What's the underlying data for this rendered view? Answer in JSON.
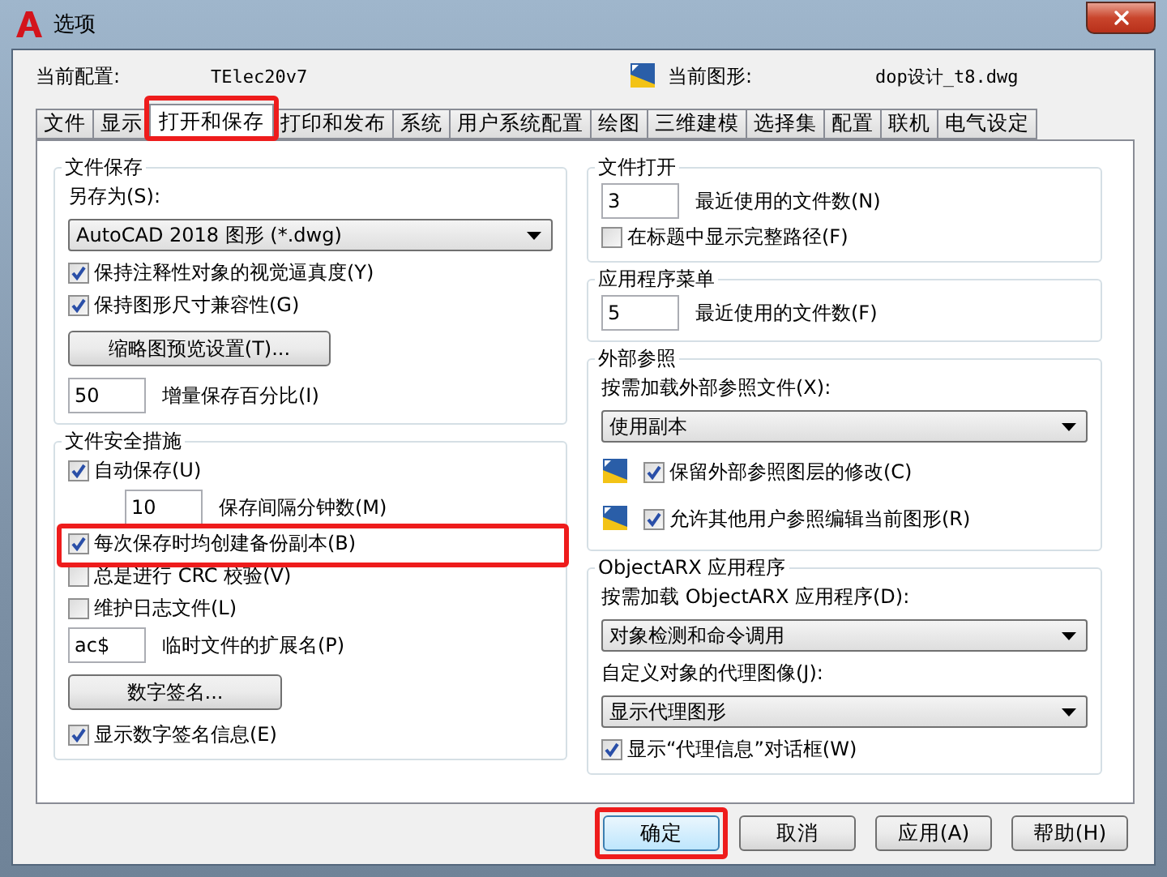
{
  "window": {
    "title": "选项"
  },
  "header": {
    "profile_label": "当前配置:",
    "profile": "TElec20v7",
    "drawing_label": "当前图形:",
    "drawing": "dop设计_t8.dwg"
  },
  "tabs": [
    {
      "label": "文件",
      "selected": false,
      "highlighted": false
    },
    {
      "label": "显示",
      "selected": false,
      "highlighted": false
    },
    {
      "label": "打开和保存",
      "selected": true,
      "highlighted": true
    },
    {
      "label": "打印和发布",
      "selected": false,
      "highlighted": false
    },
    {
      "label": "系统",
      "selected": false,
      "highlighted": false
    },
    {
      "label": "用户系统配置",
      "selected": false,
      "highlighted": false
    },
    {
      "label": "绘图",
      "selected": false,
      "highlighted": false
    },
    {
      "label": "三维建模",
      "selected": false,
      "highlighted": false
    },
    {
      "label": "选择集",
      "selected": false,
      "highlighted": false
    },
    {
      "label": "配置",
      "selected": false,
      "highlighted": false
    },
    {
      "label": "联机",
      "selected": false,
      "highlighted": false
    },
    {
      "label": "电气设定",
      "selected": false,
      "highlighted": false
    }
  ],
  "columns": [
    [
      {
        "title": "文件保存",
        "items": [
          {
            "kind": "label",
            "text": "另存为(S):"
          },
          {
            "kind": "select",
            "value": "AutoCAD 2018 图形 (*.dwg)"
          },
          {
            "kind": "checkbox",
            "label": "保持注释性对象的视觉逼真度(Y)",
            "checked": true,
            "highlighted": false
          },
          {
            "kind": "checkbox",
            "label": "保持图形尺寸兼容性(G)",
            "checked": true,
            "highlighted": false
          },
          {
            "kind": "button",
            "label": "缩略图预览设置(T)..."
          },
          {
            "kind": "field",
            "caption": "增量保存百分比(I)",
            "value": "50"
          }
        ]
      },
      {
        "title": "文件安全措施",
        "items": [
          {
            "kind": "checkbox",
            "label": "自动保存(U)",
            "checked": true,
            "highlighted": false
          },
          {
            "kind": "indented-field",
            "caption": "保存间隔分钟数(M)",
            "value": "10"
          },
          {
            "kind": "checkbox",
            "label": "每次保存时均创建备份副本(B)",
            "checked": true,
            "highlighted": true
          },
          {
            "kind": "checkbox",
            "label": "总是进行 CRC 校验(V)",
            "checked": false,
            "highlighted": false
          },
          {
            "kind": "checkbox",
            "label": "维护日志文件(L)",
            "checked": false,
            "highlighted": false
          },
          {
            "kind": "field",
            "caption": "临时文件的扩展名(P)",
            "value": "ac$"
          },
          {
            "kind": "button",
            "label": "数字签名..."
          },
          {
            "kind": "checkbox",
            "label": "显示数字签名信息(E)",
            "checked": true,
            "highlighted": false
          }
        ]
      }
    ],
    [
      {
        "title": "文件打开",
        "items": [
          {
            "kind": "field",
            "caption": "最近使用的文件数(N)",
            "value": "3"
          },
          {
            "kind": "checkbox",
            "label": "在标题中显示完整路径(F)",
            "checked": false,
            "highlighted": false
          }
        ]
      },
      {
        "title": "应用程序菜单",
        "items": [
          {
            "kind": "field",
            "caption": "最近使用的文件数(F)",
            "value": "5"
          }
        ]
      },
      {
        "title": "外部参照",
        "items": [
          {
            "kind": "label",
            "text": "按需加载外部参照文件(X):"
          },
          {
            "kind": "select",
            "value": "使用副本"
          },
          {
            "kind": "icon-checkbox",
            "label": "保留外部参照图层的修改(C)",
            "checked": true,
            "highlighted": false
          },
          {
            "kind": "icon-checkbox",
            "label": "允许其他用户参照编辑当前图形(R)",
            "checked": true,
            "highlighted": false
          }
        ]
      },
      {
        "title": "ObjectARX 应用程序",
        "items": [
          {
            "kind": "label",
            "text": "按需加载 ObjectARX 应用程序(D):"
          },
          {
            "kind": "select",
            "value": "对象检测和命令调用"
          },
          {
            "kind": "label",
            "text": "自定义对象的代理图像(J):"
          },
          {
            "kind": "select",
            "value": "显示代理图形"
          },
          {
            "kind": "checkbox",
            "label": "显示“代理信息”对话框(W)",
            "checked": true,
            "highlighted": false
          }
        ]
      }
    ]
  ],
  "buttons": [
    {
      "label": "确定",
      "highlighted": true
    },
    {
      "label": "取消",
      "highlighted": false
    },
    {
      "label": "应用(A)",
      "highlighted": false
    },
    {
      "label": "帮助(H)",
      "highlighted": false
    }
  ]
}
